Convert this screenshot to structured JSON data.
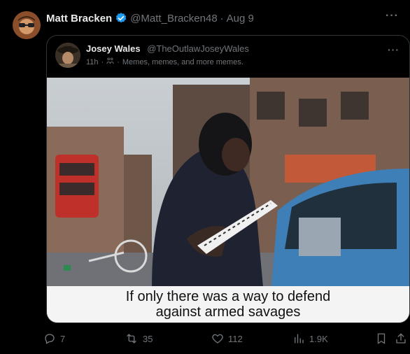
{
  "tweet": {
    "author_name": "Matt Bracken",
    "author_handle": "@Matt_Bracken48",
    "separator": "·",
    "date": "Aug 9",
    "more_icon": "more-horizontal-icon",
    "verified_color": "#1d9bf0"
  },
  "quote": {
    "author_name": "Josey Wales",
    "author_handle": "@TheOutlawJoseyWales",
    "time": "11h",
    "separator": "·",
    "community": "Memes, memes, and more memes.",
    "image_caption_line1": "If only there was a way to defend",
    "image_caption_line2": "against armed savages"
  },
  "actions": {
    "replies": "7",
    "reposts": "35",
    "likes": "112",
    "views": "1.9K"
  }
}
